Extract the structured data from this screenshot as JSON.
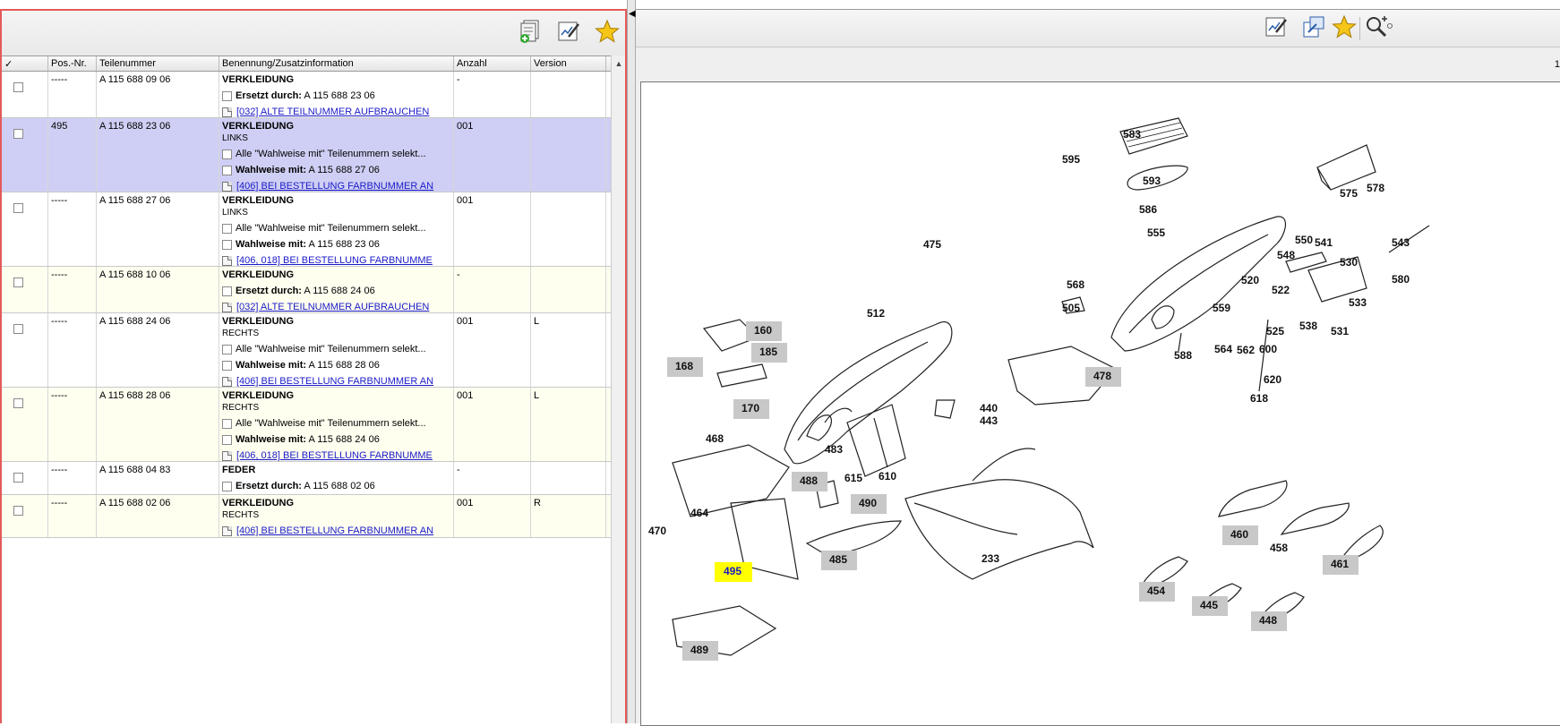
{
  "columns": [
    "✓",
    "Pos.-Nr.",
    "Teilenummer",
    "Benennung/Zusatzinformation",
    "Anzahl",
    "Version"
  ],
  "rows": [
    {
      "pos": "-----",
      "part": "A 115 688 09 06",
      "name": "VERKLEIDUNG",
      "sub": "",
      "qty": "-",
      "ver": "",
      "lines": [
        {
          "kind": "cb",
          "bold": "Ersetzt durch:",
          "text": " A 115 688 23 06"
        },
        {
          "kind": "doc",
          "text": "[032] ALTE TEILNUMMER AUFBRAUCHEN"
        }
      ]
    },
    {
      "pos": "495",
      "part": "A 115 688 23 06",
      "name": "VERKLEIDUNG",
      "sub": "LINKS",
      "qty": "001",
      "ver": "",
      "lines": [
        {
          "kind": "cb",
          "bold": "",
          "text": "Alle \"Wahlweise mit\" Teilenummern selekt..."
        },
        {
          "kind": "cb",
          "bold": "Wahlweise mit:",
          "text": " A 115 688 27 06"
        },
        {
          "kind": "doc",
          "text": "[406] BEI BESTELLUNG FARBNUMMER AN"
        }
      ]
    },
    {
      "pos": "-----",
      "part": "A 115 688 27 06",
      "name": "VERKLEIDUNG",
      "sub": "LINKS",
      "qty": "001",
      "ver": "",
      "lines": [
        {
          "kind": "cb",
          "bold": "",
          "text": "Alle \"Wahlweise mit\" Teilenummern selekt..."
        },
        {
          "kind": "cb",
          "bold": "Wahlweise mit:",
          "text": " A 115 688 23 06"
        },
        {
          "kind": "doc",
          "text": "[406, 018] BEI BESTELLUNG FARBNUMME"
        }
      ]
    },
    {
      "pos": "-----",
      "part": "A 115 688 10 06",
      "name": "VERKLEIDUNG",
      "sub": "",
      "qty": "-",
      "ver": "",
      "lines": [
        {
          "kind": "cb",
          "bold": "Ersetzt durch:",
          "text": " A 115 688 24 06"
        },
        {
          "kind": "doc",
          "text": "[032] ALTE TEILNUMMER AUFBRAUCHEN"
        }
      ]
    },
    {
      "pos": "-----",
      "part": "A 115 688 24 06",
      "name": "VERKLEIDUNG",
      "sub": "RECHTS",
      "qty": "001",
      "ver": "L",
      "lines": [
        {
          "kind": "cb",
          "bold": "",
          "text": "Alle \"Wahlweise mit\" Teilenummern selekt..."
        },
        {
          "kind": "cb",
          "bold": "Wahlweise mit:",
          "text": " A 115 688 28 06"
        },
        {
          "kind": "doc",
          "text": "[406] BEI BESTELLUNG FARBNUMMER AN"
        }
      ]
    },
    {
      "pos": "-----",
      "part": "A 115 688 28 06",
      "name": "VERKLEIDUNG",
      "sub": "RECHTS",
      "qty": "001",
      "ver": "L",
      "lines": [
        {
          "kind": "cb",
          "bold": "",
          "text": "Alle \"Wahlweise mit\" Teilenummern selekt..."
        },
        {
          "kind": "cb",
          "bold": "Wahlweise mit:",
          "text": " A 115 688 24 06"
        },
        {
          "kind": "doc",
          "text": "[406, 018] BEI BESTELLUNG FARBNUMME"
        }
      ]
    },
    {
      "pos": "-----",
      "part": "A 115 688 04 83",
      "name": "FEDER",
      "sub": "",
      "qty": "-",
      "ver": "",
      "lines": [
        {
          "kind": "cb",
          "bold": "Ersetzt durch:",
          "text": " A 115 688 02 06"
        }
      ]
    },
    {
      "pos": "-----",
      "part": "A 115 688 02 06",
      "name": "VERKLEIDUNG",
      "sub": "RECHTS",
      "qty": "001",
      "ver": "R",
      "lines": [
        {
          "kind": "doc",
          "text": "[406] BEI BESTELLUNG FARBNUMMER AN"
        }
      ]
    }
  ],
  "page_indicator": "1",
  "callouts": [
    "583",
    "595",
    "593",
    "575",
    "578",
    "586",
    "555",
    "475",
    "543",
    "550",
    "541",
    "548",
    "530",
    "580",
    "568",
    "505",
    "520",
    "522",
    "533",
    "525",
    "538",
    "531",
    "559",
    "564",
    "562",
    "600",
    "620",
    "618",
    "588",
    "512",
    "160",
    "185",
    "168",
    "478",
    "170",
    "440",
    "443",
    "468",
    "483",
    "615",
    "610",
    "488",
    "490",
    "460",
    "470",
    "464",
    "458",
    "495",
    "485",
    "233",
    "461",
    "454",
    "445",
    "448",
    "489"
  ],
  "highlight_color": "#ffff00",
  "selected_row_color": "#cfcff5"
}
